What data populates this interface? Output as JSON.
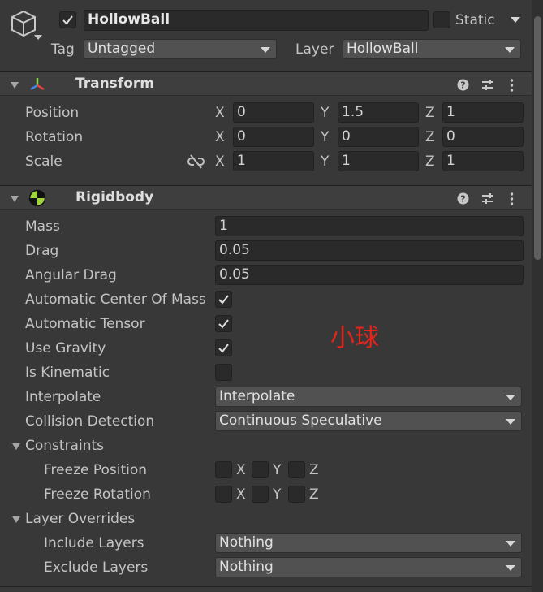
{
  "object": {
    "name": "HollowBall",
    "active": true,
    "static_label": "Static",
    "static_checked": false,
    "tag_label": "Tag",
    "tag_value": "Untagged",
    "layer_label": "Layer",
    "layer_value": "HollowBall"
  },
  "transform": {
    "title": "Transform",
    "rows": [
      {
        "label": "Position",
        "x": "0",
        "y": "1.5",
        "z": "1"
      },
      {
        "label": "Rotation",
        "x": "0",
        "y": "0",
        "z": "0"
      },
      {
        "label": "Scale",
        "x": "1",
        "y": "1",
        "z": "1"
      }
    ],
    "axis_x": "X",
    "axis_y": "Y",
    "axis_z": "Z"
  },
  "rigidbody": {
    "title": "Rigidbody",
    "mass_label": "Mass",
    "mass": "1",
    "drag_label": "Drag",
    "drag": "0.05",
    "angular_drag_label": "Angular Drag",
    "angular_drag": "0.05",
    "auto_com_label": "Automatic Center Of Mass",
    "auto_com": true,
    "auto_tensor_label": "Automatic Tensor",
    "auto_tensor": true,
    "use_gravity_label": "Use Gravity",
    "use_gravity": true,
    "is_kinematic_label": "Is Kinematic",
    "is_kinematic": false,
    "interpolate_label": "Interpolate",
    "interpolate": "Interpolate",
    "collision_label": "Collision Detection",
    "collision": "Continuous Speculative",
    "constraints_label": "Constraints",
    "freeze_position_label": "Freeze Position",
    "freeze_rotation_label": "Freeze Rotation",
    "cx": "X",
    "cy": "Y",
    "cz": "Z",
    "layer_overrides_label": "Layer Overrides",
    "include_layers_label": "Include Layers",
    "include_layers": "Nothing",
    "exclude_layers_label": "Exclude Layers",
    "exclude_layers": "Nothing"
  },
  "annotation": {
    "text": "小球",
    "color": "#e8231a"
  }
}
